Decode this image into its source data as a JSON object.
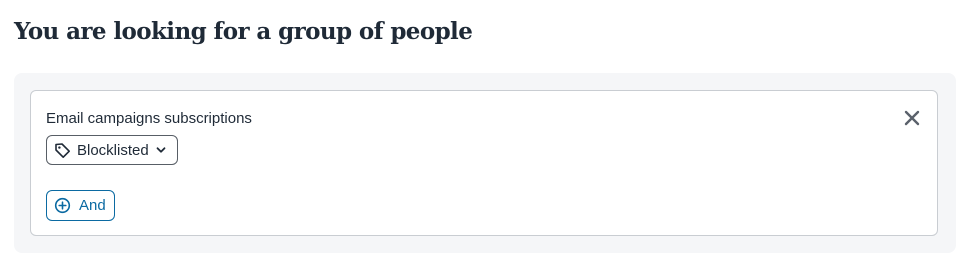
{
  "page": {
    "title": "You are looking for a group of people"
  },
  "condition": {
    "label": "Email campaigns subscriptions",
    "filter": {
      "selected": "Blocklisted",
      "icon": "tag-icon"
    },
    "remove_icon": "close-icon",
    "and_button": {
      "label": "And",
      "icon": "plus-circle-icon"
    }
  },
  "colors": {
    "text": "#1f2a37",
    "accent": "#0b6aa2",
    "card_border": "#c9cdd2",
    "panel_bg": "#f5f6f8"
  }
}
